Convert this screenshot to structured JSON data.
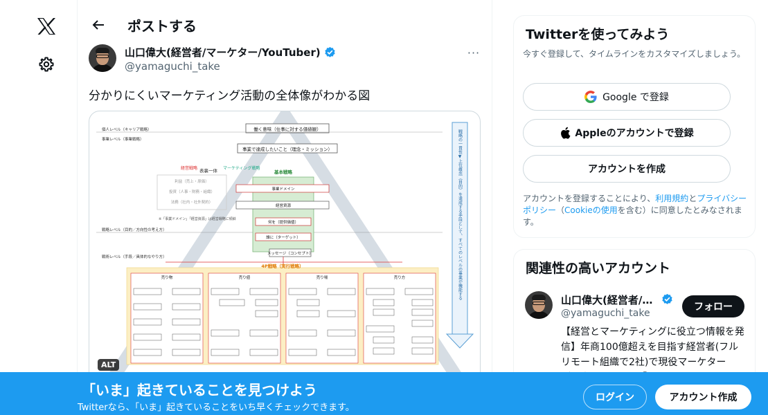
{
  "nav": {
    "logo_icon": "x-logo-icon",
    "settings_icon": "gear-icon"
  },
  "header": {
    "back_icon": "arrow-left-icon",
    "title": "ポストする"
  },
  "post": {
    "author_name": "山口偉大(経営者/マーケター/YouTuber)",
    "author_handle": "@yamaguchi_take",
    "more_icon": "more-icon",
    "more_text": "···",
    "text": "分かりにくいマーケティング活動の全体像がわかる図",
    "alt_label": "ALT",
    "image": {
      "top_box_1": "働く意味（仕事に対する価値観）",
      "top_box_2": "事業で達成したいこと（理念・ミッション）",
      "level_1": "個人レベル（キャリア戦略）",
      "level_2": "事業レベル（事業戦略）",
      "level_3": "戦略レベル（目的／方向性の考え方）",
      "level_4": "戦術レベル（手段／具体的なやり方）",
      "omote": "表裏一体",
      "keiei": "経営戦略",
      "marketing": "マーケティング戦略",
      "basic": "基本戦略",
      "b1": "事業ドメイン",
      "b2": "経営資源",
      "b3": "何を（提供価値）",
      "b4": "誰に（ターゲット）",
      "b5": "メッセージ（コンセプト）",
      "l1": "利益（売上・原価）",
      "l2": "投資（人事・財務・組織）",
      "l3": "法務（社内・社外契約）",
      "note": "※「事業ドメイン」「経営資源」は経営戦略に傾斜",
      "fourp": "4P戦略（実行戦略）",
      "p1": "売り物",
      "p2": "売り値",
      "p3": "売り場",
      "p4": "売り方",
      "side": "戦略の一貫性▼上位概念（目的）を達成する手段として、すべてのレベルの事業が機能する"
    }
  },
  "signup_card": {
    "title": "Twitterを使ってみよう",
    "subtitle": "今すぐ登録して、タイムラインをカスタマイズしましょう。",
    "google_label": "Google で登録",
    "apple_label": "Appleのアカウントで登録",
    "create_label": "アカウントを作成",
    "legal_1": "アカウントを登録することにより、",
    "legal_terms": "利用規約",
    "legal_and": "と",
    "legal_privacy": "プライバシーポリシー",
    "legal_paren_open": "（",
    "legal_cookie": "Cookieの使用",
    "legal_2": "を含む）に同意したとみなされます。"
  },
  "related": {
    "title": "関連性の高いアカウント",
    "name": "山口偉大(経営者/…",
    "handle": "@yamaguchi_take",
    "follow_label": "フォロー",
    "bio": "【経営とマーケティングに役立つ情報を発信】年商100億超えを目指す経営者(フルリモート組織で2社)で現役マーケター（代表作のSNS×「動画とウリ"
  },
  "banner": {
    "title": "「いま」起きていることを見つけよう",
    "subtitle": "Twitterなら、「いま」起きていることをいち早くチェックできます。",
    "login_label": "ログイン",
    "signup_label": "アカウント作成"
  },
  "colors": {
    "brand": "#1d9bf0",
    "text": "#0f1419",
    "muted": "#536471"
  }
}
